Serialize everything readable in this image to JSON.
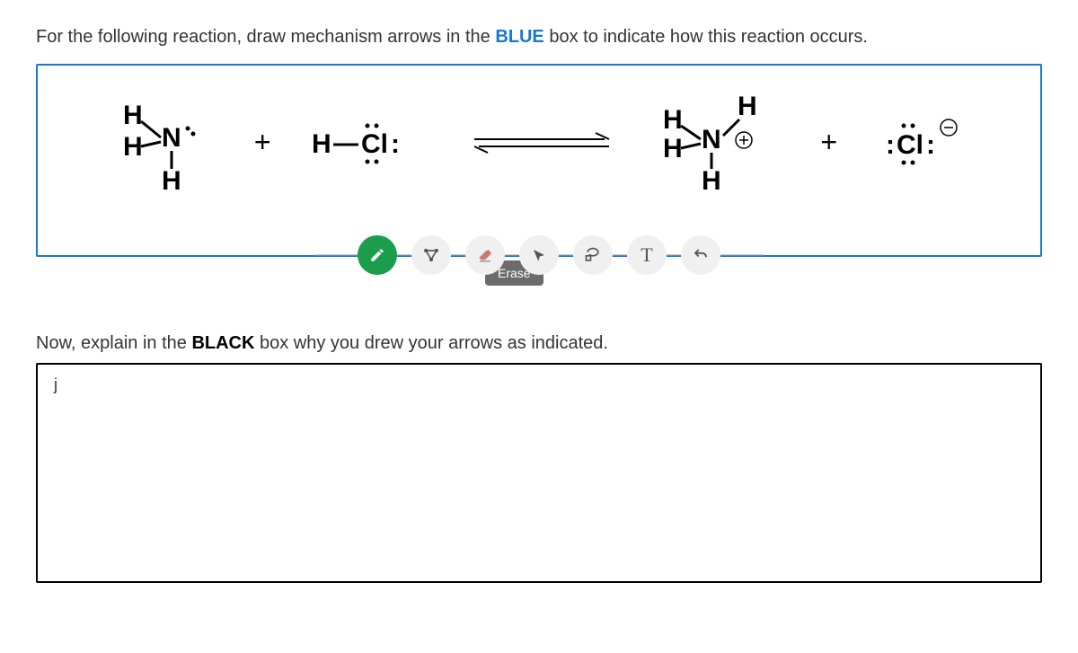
{
  "prompt1_part1": "For the following reaction, draw mechanism arrows in the ",
  "prompt1_blue": "BLUE",
  "prompt1_part2": " box to indicate how this reaction occurs.",
  "plus": "+",
  "tooltip_erase": "Erase",
  "toolbar": {
    "pen": "pen",
    "structure": "structure",
    "erase": "erase",
    "arrow": "arrow",
    "lasso": "lasso",
    "text": "T",
    "undo": "undo"
  },
  "prompt2_part1": "Now, explain in the ",
  "prompt2_black": "BLACK",
  "prompt2_part2": " box why you drew your arrows as indicated.",
  "black_box_content": "j",
  "chart_data": {
    "type": "diagram",
    "reaction": "acid-base proton transfer",
    "reactants": [
      {
        "formula": "NH3 (trimethyl-like amine shown as H3N with lone pair)",
        "lonepairs": 1
      },
      {
        "formula": "H-Cl",
        "lonepairs_on_Cl": 3
      }
    ],
    "products": [
      {
        "formula": "NH4+ (ammonium)",
        "charge": "+"
      },
      {
        "formula": "Cl-",
        "charge": "-",
        "lonepairs": 4
      }
    ],
    "arrow_type": "equilibrium"
  }
}
